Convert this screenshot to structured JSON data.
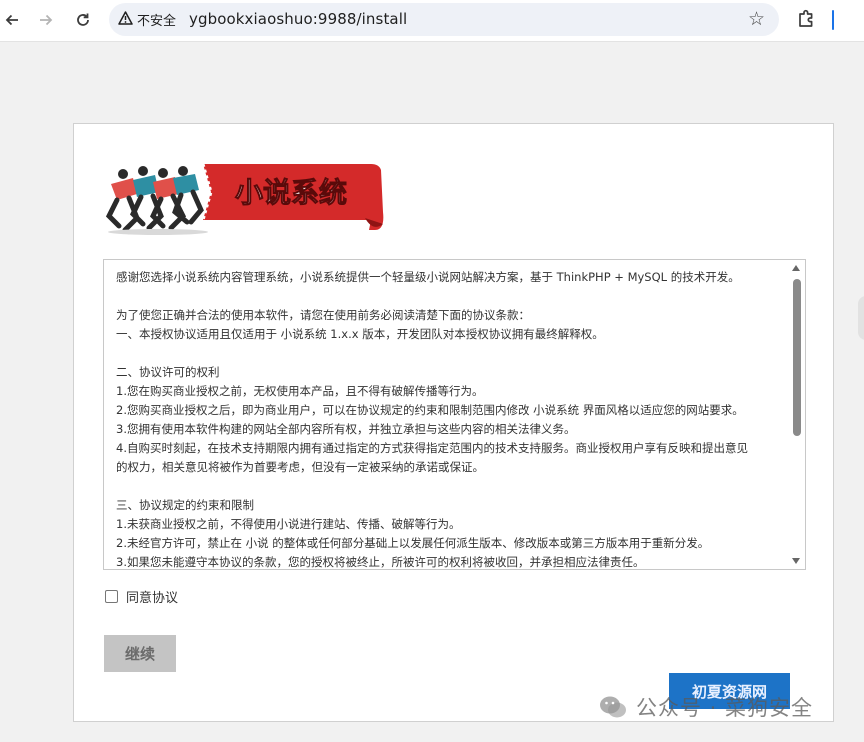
{
  "browser": {
    "security_label": "不安全",
    "url": "ygbookxiaoshuo:9988/install",
    "icons": [
      "back-icon",
      "forward-icon",
      "reload-icon",
      "warning-icon",
      "star-icon",
      "extensions-icon"
    ]
  },
  "installer": {
    "logo_text": "小说系统",
    "license_lines": [
      "感谢您选择小说系统内容管理系统，小说系统提供一个轻量级小说网站解决方案，基于 ThinkPHP + MySQL 的技术开发。",
      "",
      "为了使您正确并合法的使用本软件，请您在使用前务必阅读清楚下面的协议条款：",
      "一、本授权协议适用且仅适用于 小说系统 1.x.x 版本，开发团队对本授权协议拥有最终解释权。",
      "",
      "二、协议许可的权利",
      "1.您在购买商业授权之前，无权使用本产品，且不得有破解传播等行为。",
      "2.您购买商业授权之后，即为商业用户，可以在协议规定的约束和限制范围内修改 小说系统 界面风格以适应您的网站要求。",
      "3.您拥有使用本软件构建的网站全部内容所有权，并独立承担与这些内容的相关法律义务。",
      "4.自购买时刻起，在技术支持期限内拥有通过指定的方式获得指定范围内的技术支持服务。商业授权用户享有反映和提出意见",
      "的权力，相关意见将被作为首要考虑，但没有一定被采纳的承诺或保证。",
      "",
      "三、协议规定的约束和限制",
      "1.未获商业授权之前，不得使用小说进行建站、传播、破解等行为。",
      "2.未经官方许可，禁止在 小说 的整体或任何部分基础上以发展任何派生版本、修改版本或第三方版本用于重新分发。",
      "3.如果您未能遵守本协议的条款，您的授权将被终止，所被许可的权利将被收回，并承担相应法律责任。"
    ],
    "agree_label": "同意协议",
    "continue_label": "继续",
    "promo_label": "初夏资源网"
  },
  "watermark": {
    "text": "公众号 · 菜狗安全"
  },
  "colors": {
    "promo_bg": "#1d73c7",
    "continue_bg": "#c4c4c4",
    "logo_ribbon": "#d42a2a"
  }
}
